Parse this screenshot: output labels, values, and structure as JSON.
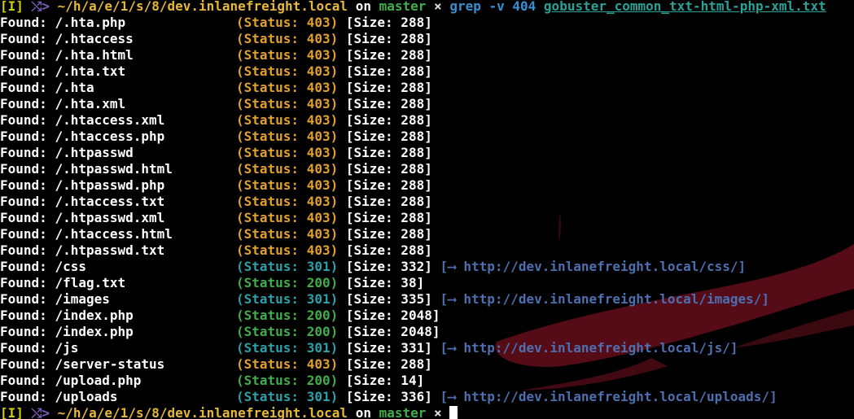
{
  "colors": {
    "background": "#000000",
    "status_403": "#e0a030",
    "status_301": "#2aa0a8",
    "status_200": "#3fae4b",
    "redirect": "#4d6fb0",
    "prompt_path": "#e5b83a",
    "branch": "#3fae4b",
    "command": "#3a8fd0"
  },
  "prompt": {
    "bracket": "[I]",
    "arrow": "⤭>",
    "path": "~/h/a/e/1/s/8/dev.inlanefreight.local",
    "on": "on",
    "branch": "master",
    "dirty": "×"
  },
  "command": {
    "name": "grep",
    "args": "-v 404",
    "file": "gobuster_common_txt-html-php-xml.txt"
  },
  "results": [
    {
      "found": "Found:",
      "path": "/.hta.php",
      "status": "(Status: 403)",
      "code": "403",
      "size": "[Size: 288]"
    },
    {
      "found": "Found:",
      "path": "/.htaccess",
      "status": "(Status: 403)",
      "code": "403",
      "size": "[Size: 288]"
    },
    {
      "found": "Found:",
      "path": "/.hta.html",
      "status": "(Status: 403)",
      "code": "403",
      "size": "[Size: 288]"
    },
    {
      "found": "Found:",
      "path": "/.hta.txt",
      "status": "(Status: 403)",
      "code": "403",
      "size": "[Size: 288]"
    },
    {
      "found": "Found:",
      "path": "/.hta",
      "status": "(Status: 403)",
      "code": "403",
      "size": "[Size: 288]"
    },
    {
      "found": "Found:",
      "path": "/.hta.xml",
      "status": "(Status: 403)",
      "code": "403",
      "size": "[Size: 288]"
    },
    {
      "found": "Found:",
      "path": "/.htaccess.xml",
      "status": "(Status: 403)",
      "code": "403",
      "size": "[Size: 288]"
    },
    {
      "found": "Found:",
      "path": "/.htaccess.php",
      "status": "(Status: 403)",
      "code": "403",
      "size": "[Size: 288]"
    },
    {
      "found": "Found:",
      "path": "/.htpasswd",
      "status": "(Status: 403)",
      "code": "403",
      "size": "[Size: 288]"
    },
    {
      "found": "Found:",
      "path": "/.htpasswd.html",
      "status": "(Status: 403)",
      "code": "403",
      "size": "[Size: 288]"
    },
    {
      "found": "Found:",
      "path": "/.htpasswd.php",
      "status": "(Status: 403)",
      "code": "403",
      "size": "[Size: 288]"
    },
    {
      "found": "Found:",
      "path": "/.htaccess.txt",
      "status": "(Status: 403)",
      "code": "403",
      "size": "[Size: 288]"
    },
    {
      "found": "Found:",
      "path": "/.htpasswd.xml",
      "status": "(Status: 403)",
      "code": "403",
      "size": "[Size: 288]"
    },
    {
      "found": "Found:",
      "path": "/.htaccess.html",
      "status": "(Status: 403)",
      "code": "403",
      "size": "[Size: 288]"
    },
    {
      "found": "Found:",
      "path": "/.htpasswd.txt",
      "status": "(Status: 403)",
      "code": "403",
      "size": "[Size: 288]"
    },
    {
      "found": "Found:",
      "path": "/css",
      "status": "(Status: 301)",
      "code": "301",
      "size": "[Size: 332]",
      "redirect": "[⟶ http://dev.inlanefreight.local/css/]"
    },
    {
      "found": "Found:",
      "path": "/flag.txt",
      "status": "(Status: 200)",
      "code": "200",
      "size": "[Size: 38]"
    },
    {
      "found": "Found:",
      "path": "/images",
      "status": "(Status: 301)",
      "code": "301",
      "size": "[Size: 335]",
      "redirect": "[⟶ http://dev.inlanefreight.local/images/]"
    },
    {
      "found": "Found:",
      "path": "/index.php",
      "status": "(Status: 200)",
      "code": "200",
      "size": "[Size: 2048]"
    },
    {
      "found": "Found:",
      "path": "/index.php",
      "status": "(Status: 200)",
      "code": "200",
      "size": "[Size: 2048]"
    },
    {
      "found": "Found:",
      "path": "/js",
      "status": "(Status: 301)",
      "code": "301",
      "size": "[Size: 331]",
      "redirect": "[⟶ http://dev.inlanefreight.local/js/]"
    },
    {
      "found": "Found:",
      "path": "/server-status",
      "status": "(Status: 403)",
      "code": "403",
      "size": "[Size: 288]"
    },
    {
      "found": "Found:",
      "path": "/upload.php",
      "status": "(Status: 200)",
      "code": "200",
      "size": "[Size: 14]"
    },
    {
      "found": "Found:",
      "path": "/uploads",
      "status": "(Status: 301)",
      "code": "301",
      "size": "[Size: 336]",
      "redirect": "[⟶ http://dev.inlanefreight.local/uploads/]"
    }
  ]
}
